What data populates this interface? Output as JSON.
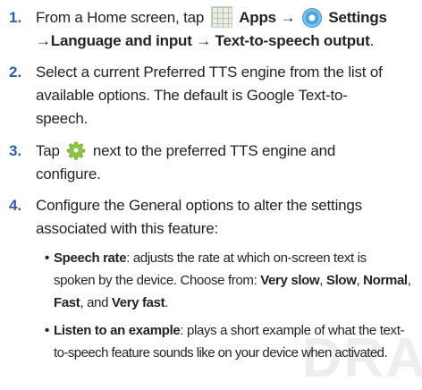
{
  "watermark": "DRA",
  "steps": [
    {
      "num": "1.",
      "pre": "From a Home screen, tap",
      "apps_label": "Apps",
      "arrow1": "→",
      "settings_label": "Settings",
      "line2_bold": "→Language and input → Text-to-speech output",
      "line2_end": "."
    },
    {
      "num": "2.",
      "line1": "Select a current Preferred TTS engine from the list of",
      "line2": "available options. The default is Google Text-to-",
      "line3": "speech."
    },
    {
      "num": "3.",
      "pre": "Tap",
      "post": "next to the preferred TTS engine and",
      "line2": "configure."
    },
    {
      "num": "4.",
      "line1": "Configure the General options to alter the settings",
      "line2": "associated with this feature:"
    }
  ],
  "bullets": [
    {
      "dot": "•",
      "term": "Speech rate",
      "l1": ": adjusts the rate at which on-screen text is",
      "l2a": "spoken by the device. Choose from: ",
      "opt1": "Very slow",
      "sep1": ", ",
      "opt2": "Slow",
      "sep2": ", ",
      "opt3": "Normal",
      "sep3": ",",
      "opt4": "Fast",
      "sep4": ", and ",
      "opt5": "Very fast",
      "end": "."
    },
    {
      "dot": "•",
      "term": "Listen to an example",
      "l1": ": plays a short example of what the text-",
      "l2": "to-speech feature sounds like on your device when activated."
    }
  ],
  "icons": {
    "apps": "apps-grid-icon",
    "settings": "settings-icon",
    "gear": "gear-icon"
  },
  "colors": {
    "step_number": "#2c5ea8",
    "text": "#232323",
    "watermark": "#eeeeee"
  }
}
